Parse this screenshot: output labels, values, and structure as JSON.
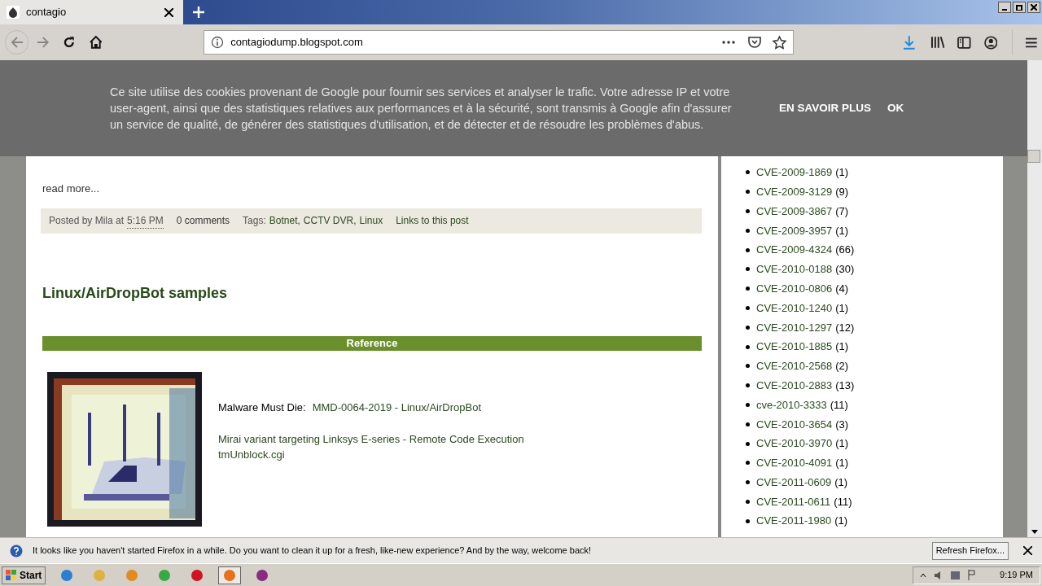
{
  "tab": {
    "title": "contagio",
    "selected": true
  },
  "address": {
    "url": "contagiodump.blogspot.com"
  },
  "cookie_banner": {
    "text": "Ce site utilise des cookies provenant de Google pour fournir ses services et analyser le trafic. Votre adresse IP et votre user-agent, ainsi que des statistiques relatives aux performances et à la sécurité, sont transmis à Google afin d'assurer un service de qualité, de générer des statistiques d'utilisation, et de détecter et de résoudre les problèmes d'abus.",
    "buttons": [
      "EN SAVOIR PLUS",
      "OK"
    ]
  },
  "post_footer": {
    "read_more": "read more...",
    "posted_by": "Posted by Mila at",
    "time": "5:16 PM",
    "comments": "0 comments",
    "tags_label": "Tags:",
    "tags": [
      "Botnet,",
      "CCTV DVR,",
      "Linux"
    ],
    "links": "Links to this post"
  },
  "post": {
    "title": "Linux/AirDropBot samples",
    "section": "Reference",
    "source_label": "Malware Must Die:",
    "source_link": "MMD-0064-2019 - Linux/AirDropBot",
    "lines": [
      "Mirai variant targeting Linksys E-series - Remote Code Execution",
      "tmUnblock.cgi"
    ]
  },
  "sidebar": {
    "labels": [
      {
        "name": "CVE-2009-1869",
        "count": "(1)"
      },
      {
        "name": "CVE-2009-3129",
        "count": "(9)"
      },
      {
        "name": "CVE-2009-3867",
        "count": "(7)"
      },
      {
        "name": "CVE-2009-3957",
        "count": "(1)"
      },
      {
        "name": "CVE-2009-4324",
        "count": "(66)"
      },
      {
        "name": "CVE-2010-0188",
        "count": "(30)"
      },
      {
        "name": "CVE-2010-0806",
        "count": "(4)"
      },
      {
        "name": "CVE-2010-1240",
        "count": "(1)"
      },
      {
        "name": "CVE-2010-1297",
        "count": "(12)"
      },
      {
        "name": "CVE-2010-1885",
        "count": "(1)"
      },
      {
        "name": "CVE-2010-2568",
        "count": "(2)"
      },
      {
        "name": "CVE-2010-2883",
        "count": "(13)"
      },
      {
        "name": "cve-2010-3333",
        "count": "(11)"
      },
      {
        "name": "CVE-2010-3654",
        "count": "(3)"
      },
      {
        "name": "CVE-2010-3970",
        "count": "(1)"
      },
      {
        "name": "CVE-2010-4091",
        "count": "(1)"
      },
      {
        "name": "CVE-2011-0609",
        "count": "(1)"
      },
      {
        "name": "CVE-2011-0611",
        "count": "(11)"
      },
      {
        "name": "CVE-2011-1980",
        "count": "(1)"
      }
    ]
  },
  "notification": {
    "text": "It looks like you haven't started Firefox in a while. Do you want to clean it up for a fresh, like-new experience? And by the way, welcome back!",
    "button": "Refresh Firefox..."
  },
  "taskbar": {
    "start": "Start",
    "clock": "9:19 PM",
    "apps": [
      {
        "selected": false
      },
      {
        "selected": false
      },
      {
        "selected": false
      },
      {
        "selected": false
      },
      {
        "selected": false
      },
      {
        "selected": true
      },
      {
        "selected": false
      }
    ]
  }
}
